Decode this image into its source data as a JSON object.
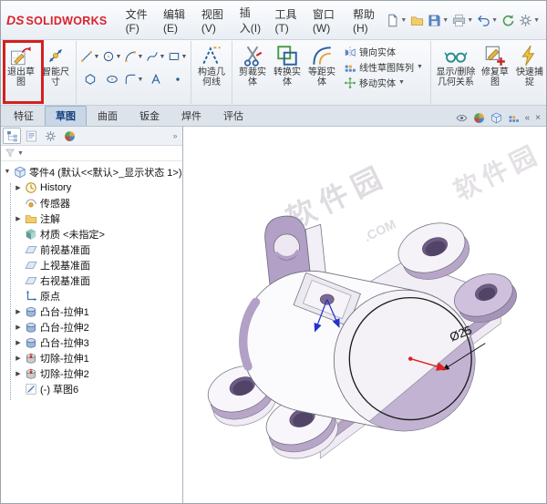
{
  "menubar": {
    "logo_ds": "DS",
    "logo_name": "SOLIDWORKS",
    "items": [
      "文件(F)",
      "编辑(E)",
      "视图(V)",
      "插入(I)",
      "工具(T)",
      "窗口(W)",
      "帮助(H)"
    ],
    "quick_icons": [
      "new-document",
      "open",
      "save",
      "print",
      "undo",
      "rebuild",
      "options"
    ]
  },
  "ribbon": {
    "buttons": {
      "exit_sketch": "退出草图",
      "smart_dimension": "智能尺寸",
      "construction_geometry": "构造几何线",
      "trim_entities": "剪裁实体",
      "convert_entities": "转换实体",
      "offset_entities": "等距实体",
      "mirror_entities": "镜向实体",
      "linear_sketch_pattern": "线性草图阵列",
      "move_entities": "移动实体",
      "display_delete_relations": "显示/删除几何关系",
      "repair_sketch": "修复草图",
      "quick_snaps": "快速捕捉"
    },
    "entity_tools": [
      "line",
      "circle",
      "arc",
      "spline",
      "rectangle",
      "polygon",
      "ellipse",
      "fillet",
      "text",
      "point"
    ]
  },
  "tabs": {
    "labels": [
      "特征",
      "草图",
      "曲面",
      "钣金",
      "焊件",
      "评估"
    ],
    "active": "草图"
  },
  "chrome": {
    "collapse": "«",
    "close": "×",
    "panel_chevron": "»",
    "filter_caret": "▼"
  },
  "feature_tree": {
    "root": "零件4 (默认<<默认>_显示状态 1>)",
    "items": [
      "History",
      "传感器",
      "注解",
      "材质 <未指定>",
      "前视基准面",
      "上视基准面",
      "右视基准面",
      "原点",
      "凸台-拉伸1",
      "凸台-拉伸2",
      "凸台-拉伸3",
      "切除-拉伸1",
      "切除-拉伸2",
      "(-) 草图6"
    ]
  },
  "viewport": {
    "dimension_label": "Ø25",
    "watermark_line1": "软件园",
    "watermark_line2": ".COM"
  },
  "colors": {
    "annotation_red": "#d42020",
    "model_purple": "#b7a6c8",
    "logo_red": "#d9232e",
    "accent_blue": "#2b5f9e"
  }
}
